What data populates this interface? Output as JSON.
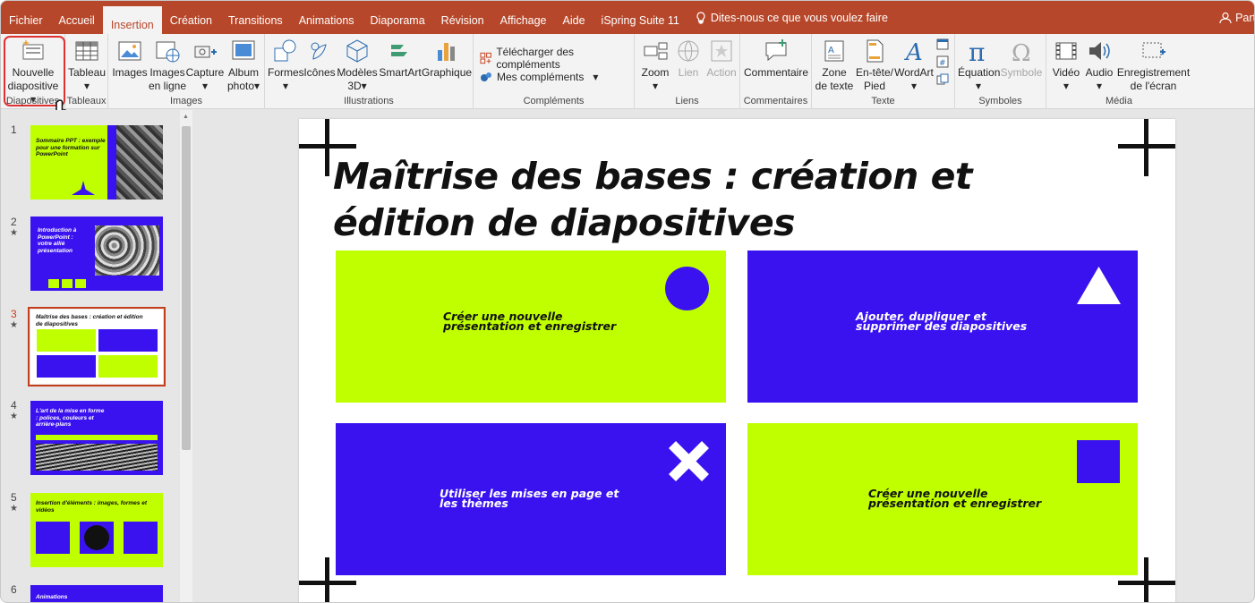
{
  "menu": [
    "Fichier",
    "Accueil",
    "Insertion",
    "Création",
    "Transitions",
    "Animations",
    "Diaporama",
    "Révision",
    "Affichage",
    "Aide",
    "iSpring Suite 11"
  ],
  "active_tab": "Insertion",
  "tellme": "Dites-nous ce que vous voulez faire",
  "share": "Part",
  "ribbon": {
    "diapositives": {
      "btn": "Nouvelle",
      "btn2": "diapositive",
      "label": "Diapositives"
    },
    "tableaux": {
      "btn": "Tableau",
      "label": "Tableaux"
    },
    "images": {
      "b1": "Images",
      "b2a": "Images",
      "b2b": "en ligne",
      "b3": "Capture",
      "b4a": "Album",
      "b4b": "photo",
      "label": "Images"
    },
    "illustrations": {
      "b1": "Formes",
      "b2": "Icônes",
      "b3a": "Modèles",
      "b3b": "3D",
      "b4": "SmartArt",
      "b5": "Graphique",
      "label": "Illustrations"
    },
    "complements": {
      "b1": "Télécharger des compléments",
      "b2": "Mes compléments",
      "label": "Compléments"
    },
    "liens": {
      "b1": "Zoom",
      "b2": "Lien",
      "b3": "Action",
      "label": "Liens"
    },
    "commentaires": {
      "b1": "Commentaire",
      "label": "Commentaires"
    },
    "texte": {
      "b1a": "Zone",
      "b1b": "de texte",
      "b2a": "En-tête/",
      "b2b": "Pied",
      "b3": "WordArt",
      "label": "Texte"
    },
    "symboles": {
      "b1": "Équation",
      "b2": "Symbole",
      "label": "Symboles"
    },
    "media": {
      "b1": "Vidéo",
      "b2": "Audio",
      "b3a": "Enregistrement",
      "b3b": "de l'écran",
      "label": "Média"
    }
  },
  "thumbs": [
    {
      "num": "1",
      "title": "Sommaire PPT : exemple pour une formation sur PowerPoint"
    },
    {
      "num": "2",
      "title": "Introduction à PowerPoint : votre allié présentation"
    },
    {
      "num": "3",
      "title": "Maîtrise des bases : création et édition de diapositives"
    },
    {
      "num": "4",
      "title": "L'art de la mise en forme : polices, couleurs et arrière-plans"
    },
    {
      "num": "5",
      "title": "Insertion d'éléments : images, formes et vidéos"
    },
    {
      "num": "6",
      "title": "Animations"
    }
  ],
  "slide": {
    "title_l1": "Maîtrise des bases : création et",
    "title_l2": "édition de diapositives",
    "cards": [
      {
        "l1": "Créer une nouvelle",
        "l2": "présentation et enregistrer"
      },
      {
        "l1": "Ajouter, dupliquer et",
        "l2": "supprimer des diapositives"
      },
      {
        "l1": "Utiliser les mises en page et",
        "l2": "les thèmes"
      },
      {
        "l1": "Créer une nouvelle",
        "l2": "présentation et enregistrer"
      }
    ]
  },
  "colors": {
    "lime": "#bfff00",
    "blue": "#3a12f0",
    "accent": "#b7472a",
    "highlight": "#e03131"
  }
}
